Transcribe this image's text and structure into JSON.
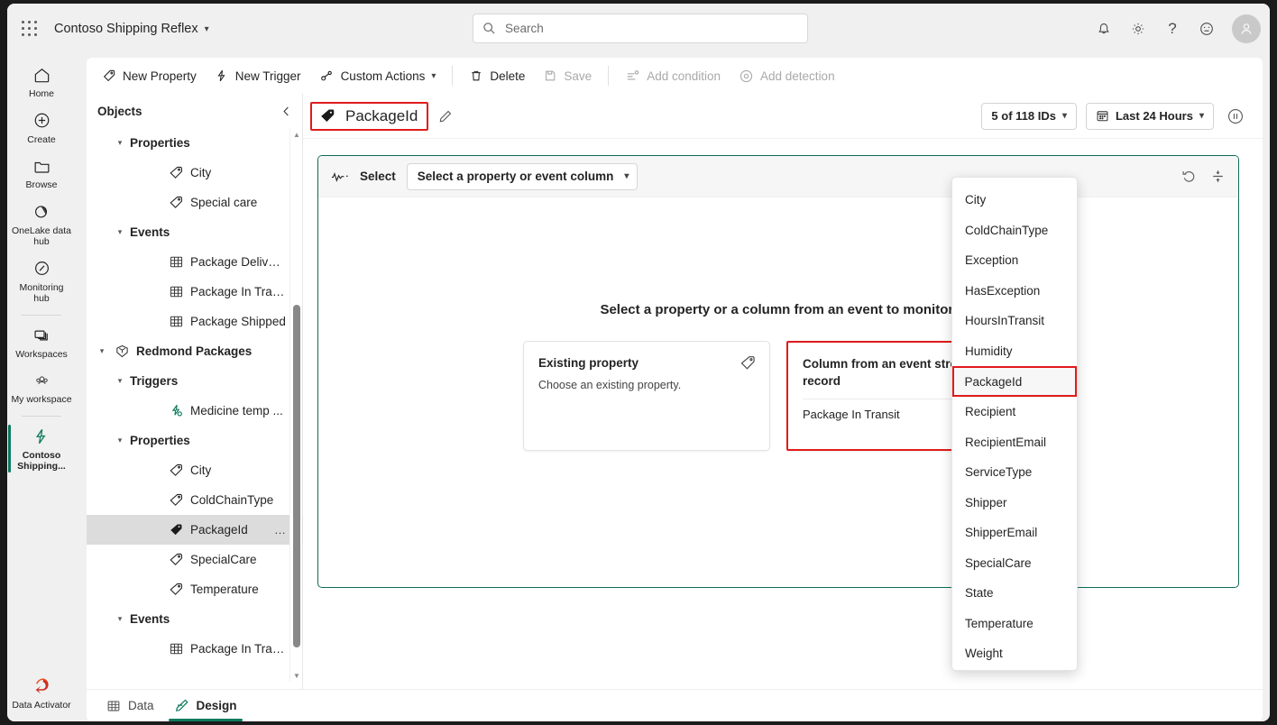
{
  "window": {
    "app_title": "Contoso Shipping Reflex"
  },
  "search": {
    "placeholder": "Search",
    "value": ""
  },
  "topbar_icons": [
    {
      "name": "notifications-icon",
      "label": "Notifications"
    },
    {
      "name": "settings-gear-icon",
      "label": "Settings"
    },
    {
      "name": "help-question-icon",
      "label": "Help"
    },
    {
      "name": "feedback-smiley-icon",
      "label": "Feedback"
    },
    {
      "name": "account-avatar",
      "label": "Account manager"
    }
  ],
  "rail": {
    "items": [
      {
        "label": "Home",
        "icon": "home-icon"
      },
      {
        "label": "Create",
        "icon": "plus-circle-icon"
      },
      {
        "label": "Browse",
        "icon": "folder-icon"
      },
      {
        "label": "OneLake data hub",
        "icon": "onelake-icon"
      },
      {
        "label": "Monitoring hub",
        "icon": "monitoring-icon"
      },
      {
        "label": "Workspaces",
        "icon": "workspaces-icon"
      },
      {
        "label": "My workspace",
        "icon": "my-workspace-icon"
      },
      {
        "label": "Contoso Shipping...",
        "icon": "reflex-bolt-icon",
        "active": true
      }
    ],
    "bottom": {
      "label": "Data Activator",
      "icon": "data-activator-icon"
    }
  },
  "toolbar": {
    "new_property": "New Property",
    "new_trigger": "New Trigger",
    "custom_actions": "Custom Actions",
    "delete": "Delete",
    "save": "Save",
    "add_condition": "Add condition",
    "add_detection": "Add detection"
  },
  "objects_pane": {
    "header": "Objects",
    "collapse_tooltip": "Collapse",
    "tree": [
      {
        "label": "Properties",
        "indent": 1,
        "icon": "none",
        "twisty": "down"
      },
      {
        "label": "City",
        "indent": 3,
        "icon": "tag",
        "twisty": "none"
      },
      {
        "label": "Special care",
        "indent": 3,
        "icon": "tag",
        "twisty": "none"
      },
      {
        "label": "Events",
        "indent": 1,
        "icon": "none",
        "twisty": "down"
      },
      {
        "label": "Package Deliver...",
        "indent": 3,
        "icon": "table",
        "twisty": "none"
      },
      {
        "label": "Package In Transit",
        "indent": 3,
        "icon": "table",
        "twisty": "none"
      },
      {
        "label": "Package Shipped",
        "indent": 3,
        "icon": "table",
        "twisty": "none"
      },
      {
        "label": "Redmond Packages",
        "indent": 0,
        "icon": "object",
        "twisty": "down"
      },
      {
        "label": "Triggers",
        "indent": 1,
        "icon": "none",
        "twisty": "down"
      },
      {
        "label": "Medicine temp ...",
        "indent": 3,
        "icon": "trigger",
        "twisty": "none"
      },
      {
        "label": "Properties",
        "indent": 1,
        "icon": "none",
        "twisty": "down"
      },
      {
        "label": "City",
        "indent": 3,
        "icon": "tag",
        "twisty": "none"
      },
      {
        "label": "ColdChainType",
        "indent": 3,
        "icon": "tag",
        "twisty": "none"
      },
      {
        "label": "PackageId",
        "indent": 3,
        "icon": "tag-filled",
        "twisty": "none",
        "selected": true,
        "overflow": "…"
      },
      {
        "label": "SpecialCare",
        "indent": 3,
        "icon": "tag",
        "twisty": "none"
      },
      {
        "label": "Temperature",
        "indent": 3,
        "icon": "tag",
        "twisty": "none"
      },
      {
        "label": "Events",
        "indent": 1,
        "icon": "none",
        "twisty": "down"
      },
      {
        "label": "Package In Transit",
        "indent": 3,
        "icon": "table",
        "twisty": "none"
      }
    ]
  },
  "canvas": {
    "property_title": "PackageId",
    "edit_tooltip": "Rename",
    "ids_pill": "5 of 118 IDs",
    "time_pill": "Last 24 Hours",
    "pause_tooltip": "Pause",
    "select_card": {
      "label": "Select",
      "combo_value": "Select a property or event column",
      "reset_tooltip": "Reset",
      "scale_tooltip": "Fit to view",
      "empty_message": "Select a property or a column from an event to monitor.",
      "option_cards": [
        {
          "title": "Existing property",
          "description": "Choose an existing property.",
          "icon": "tag-icon",
          "highlighted": false,
          "sub_item": ""
        },
        {
          "title": "Column from an event stream or record",
          "description": "",
          "icon": "",
          "highlighted": true,
          "sub_item": "Package In Transit"
        }
      ]
    }
  },
  "flyout": {
    "items": [
      {
        "label": "City"
      },
      {
        "label": "ColdChainType"
      },
      {
        "label": "Exception"
      },
      {
        "label": "HasException"
      },
      {
        "label": "HoursInTransit"
      },
      {
        "label": "Humidity"
      },
      {
        "label": "PackageId",
        "highlighted": true
      },
      {
        "label": "Recipient"
      },
      {
        "label": "RecipientEmail"
      },
      {
        "label": "ServiceType"
      },
      {
        "label": "Shipper"
      },
      {
        "label": "ShipperEmail"
      },
      {
        "label": "SpecialCare"
      },
      {
        "label": "State"
      },
      {
        "label": "Temperature"
      },
      {
        "label": "Weight"
      }
    ]
  },
  "bottom_tabs": [
    {
      "label": "Data",
      "icon": "table-icon",
      "active": false
    },
    {
      "label": "Design",
      "icon": "design-pen-icon",
      "active": true
    }
  ],
  "colors": {
    "accent_green": "#0f7a5f",
    "highlight_red": "#e01b1b",
    "chrome_gray": "#f0f0f0",
    "selected_row": "#dcdcdc"
  }
}
